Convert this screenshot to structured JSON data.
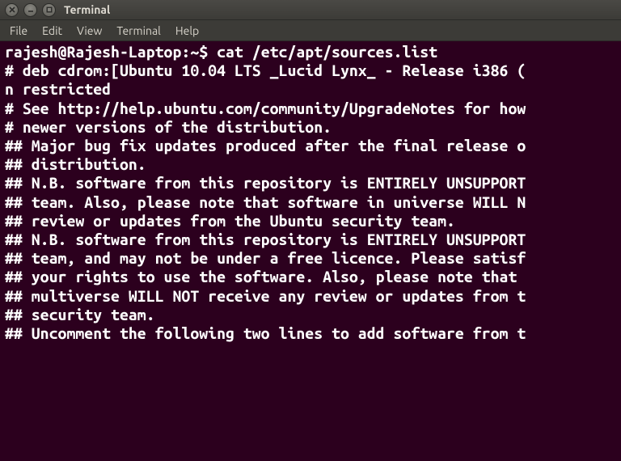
{
  "window": {
    "title": "Terminal"
  },
  "menu": {
    "items": [
      "File",
      "Edit",
      "View",
      "Terminal",
      "Help"
    ]
  },
  "terminal": {
    "prompt": "rajesh@Rajesh-Laptop:~$ ",
    "command": "cat /etc/apt/sources.list",
    "output_lines": [
      "# deb cdrom:[Ubuntu 10.04 LTS _Lucid Lynx_ - Release i386 (",
      "n restricted",
      "# See http://help.ubuntu.com/community/UpgradeNotes for how",
      "# newer versions of the distribution.",
      "",
      "",
      "## Major bug fix updates produced after the final release o",
      "## distribution.",
      "",
      "## N.B. software from this repository is ENTIRELY UNSUPPORT",
      "## team. Also, please note that software in universe WILL N",
      "## review or updates from the Ubuntu security team.",
      "",
      "## N.B. software from this repository is ENTIRELY UNSUPPORT",
      "## team, and may not be under a free licence. Please satisf",
      "## your rights to use the software. Also, please note that ",
      "## multiverse WILL NOT receive any review or updates from t",
      "## security team.",
      "",
      "## Uncomment the following two lines to add software from t"
    ]
  }
}
